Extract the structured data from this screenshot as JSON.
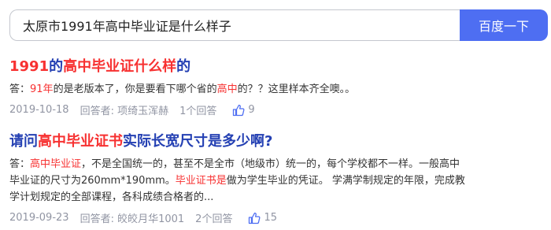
{
  "search": {
    "query": "太原市1991年高中毕业证是什么样子",
    "button_label": "百度一下"
  },
  "results": [
    {
      "title_parts": [
        "1991",
        "的",
        "高中毕业证什么样",
        "的"
      ],
      "snippet_parts": [
        "答：",
        "91年",
        "的是老版本了，你是要看下哪个省的",
        "高中",
        "的？？这里样本齐全噢。。"
      ],
      "date": "2019-10-18",
      "answerer": "回答者: 项绮玉浑赫",
      "answers": "1个回答",
      "likes": "9"
    },
    {
      "title_parts": [
        "请问",
        "高中毕业证书",
        "实际长宽尺寸是多少啊?"
      ],
      "snippet_parts": [
        "答：",
        "高中毕业证",
        "，不是全国统一的，甚至不是全市（地级市）统一的，每个学校都不一样。一般高中毕业证的尺寸为260mm*190mm。",
        "毕业证书是",
        "做为学生毕业的凭证。 学满学制规定的年限，完成教学计划规定的全部课程，各科成绩合格者的..."
      ],
      "date": "2019-09-23",
      "answerer": "回答者: 皎皎月华1001",
      "answers": "2个回答",
      "likes": "15"
    }
  ],
  "colors": {
    "accent": "#4e6ef2",
    "link": "#2440b3",
    "highlight": "#f73131",
    "meta": "#9195a3"
  },
  "icons": {
    "like": "thumb-up-icon"
  }
}
